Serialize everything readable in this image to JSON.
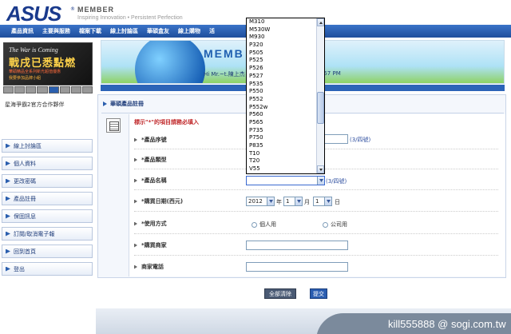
{
  "header": {
    "logo": "ASUS",
    "logo_mark": "®",
    "brand_sub": "MEMBER",
    "tagline": "Inspiring Innovation • Persistent Perfection"
  },
  "nav": {
    "items": [
      "產品資訊",
      "主要與服務",
      "檔案下載",
      "線上討論區",
      "華碩盒友",
      "線上購物",
      "活"
    ]
  },
  "promo": {
    "line1": "The War is Coming",
    "line2": "戰戌已悉點燃",
    "line3": "華碩精品全系列新光超值優惠",
    "line4": "我要參加品牌小組",
    "caption": "星海爭霸2官方合作夥伴"
  },
  "sidebar": {
    "items": [
      "線上討論區",
      "個人資料",
      "更改密碼",
      "產品註冊",
      "保固訊息",
      "訂閱/取消電子報",
      "回到首頁",
      "登出"
    ]
  },
  "hero": {
    "title": "MEMB",
    "greeting": "Hi Mr.~t.陳上杰",
    "time": ":57 PM"
  },
  "panel": {
    "title": "華碩產品註冊",
    "required_note": "標示\"*\"的項目請務必填入"
  },
  "form": {
    "serial_label": "*產品序號",
    "serial_hint": "(3/四號)",
    "type_label": "*產品類型",
    "model_label": "*產品名稱",
    "model_hint": "(3/四號)",
    "date_label": "*購買日期(西元)",
    "date_year": "2012",
    "date_year_unit": "年",
    "date_month": "1",
    "date_month_unit": "月",
    "date_day": "1",
    "date_day_unit": "日",
    "usage_label": "*使用方式",
    "usage_personal": "個人用",
    "usage_company": "公司用",
    "store_label": "*購買商家",
    "phone_label": "商家電話"
  },
  "buttons": {
    "clear": "全部清除",
    "submit": "提交"
  },
  "dropdown": {
    "options": [
      "M310",
      "M530W",
      "M930",
      "P320",
      "P505",
      "P525",
      "P526",
      "P527",
      "P535",
      "P550",
      "P552",
      "P552w",
      "P560",
      "P565",
      "P735",
      "P750",
      "P835",
      "T10",
      "T20",
      "V55"
    ]
  },
  "footer": {
    "watermark": "kill555888 @ sogi.com.tw"
  }
}
